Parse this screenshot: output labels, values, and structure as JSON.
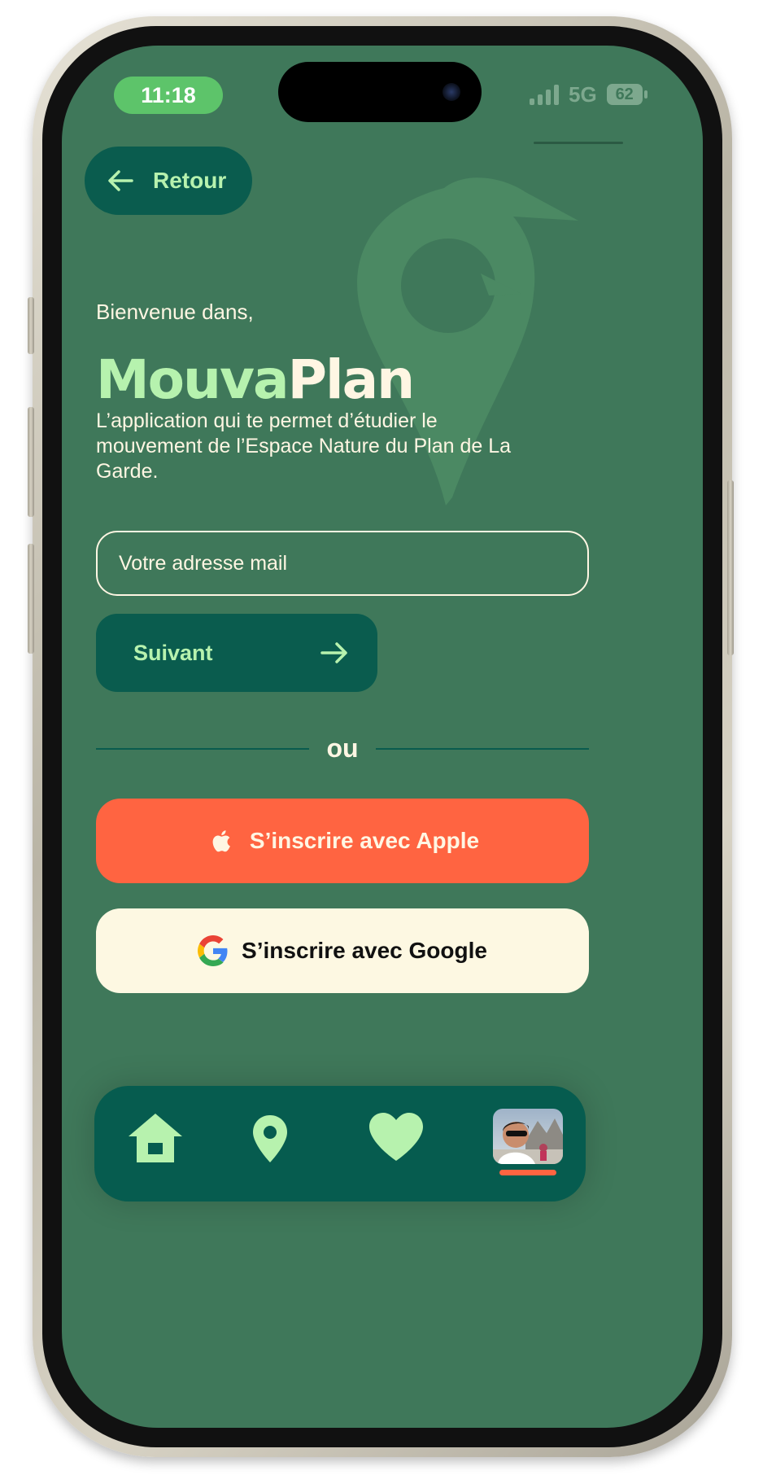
{
  "status_bar": {
    "time": "11:18",
    "network": "5G",
    "battery": "62"
  },
  "header": {
    "back_label": "Retour"
  },
  "intro": {
    "welcome": "Bienvenue dans,",
    "brand_part1": "Mouva",
    "brand_part2": "Plan",
    "tagline": "L’application qui te permet d’étudier le mouvement de l’Espace Nature du Plan de La Garde."
  },
  "form": {
    "email_placeholder": "Votre adresse mail",
    "email_value": "",
    "next_label": "Suivant"
  },
  "separator": {
    "text": "ou"
  },
  "social": {
    "apple_label": "S’inscrire avec Apple",
    "google_label": "S’inscrire avec Google"
  },
  "nav": {
    "items": [
      "home-icon",
      "location-pin-icon",
      "heart-icon",
      "profile-avatar"
    ],
    "active_item": "profile-avatar"
  },
  "colors": {
    "background": "#3f785a",
    "accent_green": "#b6f2ae",
    "dark_green": "#0a5c4e",
    "orange": "#ff6441",
    "cream": "#fdf8e2"
  }
}
